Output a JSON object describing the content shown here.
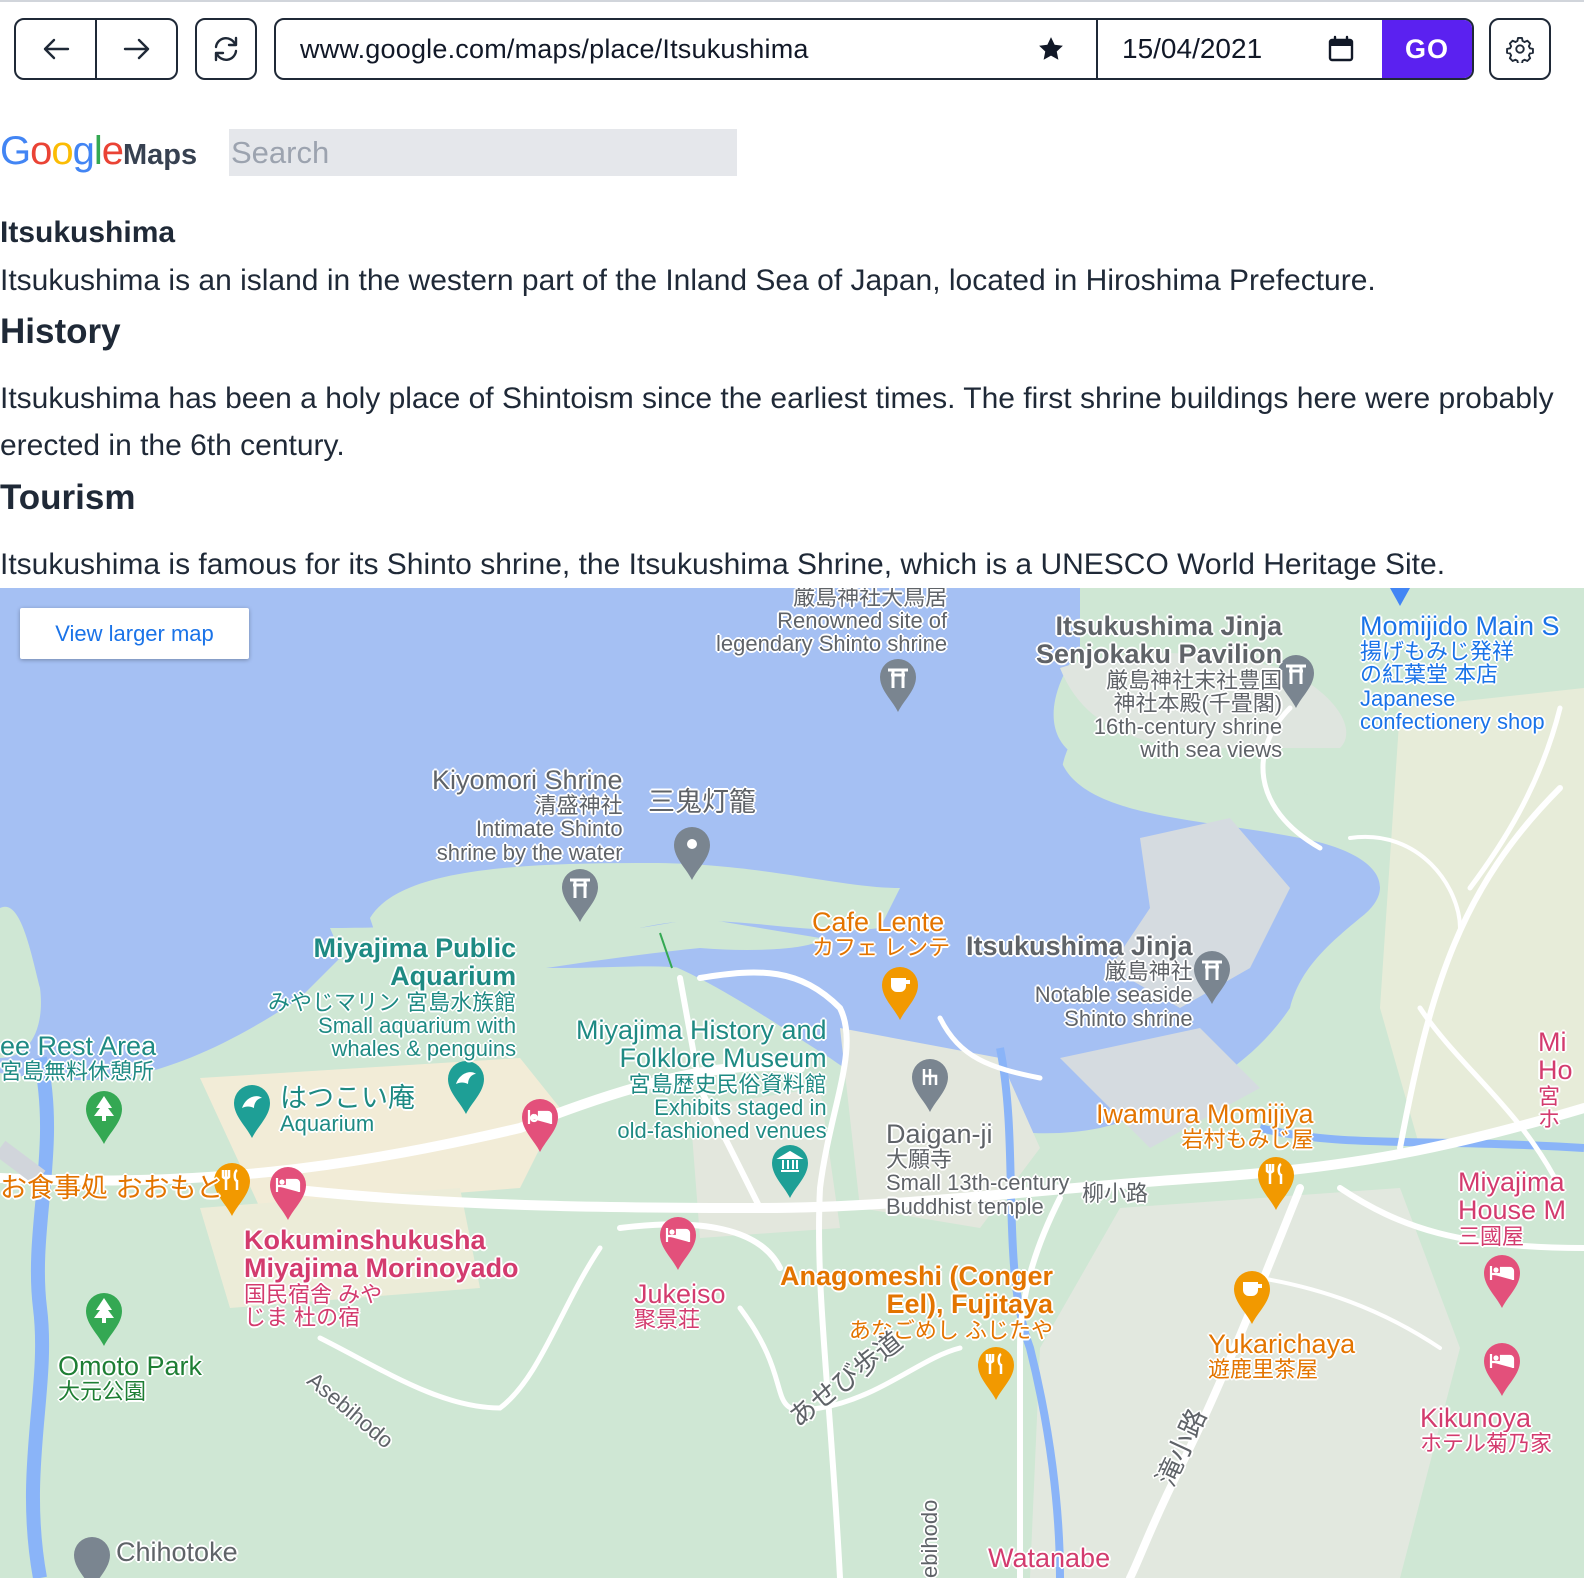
{
  "browser": {
    "url": "www.google.com/maps/place/Itsukushima",
    "date": "15/04/2021",
    "go_label": "GO",
    "icons": [
      "arrow-left-icon",
      "arrow-right-icon",
      "reload-icon",
      "star-icon",
      "calendar-icon",
      "gear-icon"
    ]
  },
  "header": {
    "logo_letters": [
      "G",
      "o",
      "o",
      "g",
      "l",
      "e"
    ],
    "maps_label": "Maps",
    "search_placeholder": "Search"
  },
  "article": {
    "title": "Itsukushima",
    "intro": "Itsukushima is an island in the western part of the Inland Sea of Japan, located in Hiroshima Prefecture.",
    "sections": [
      {
        "heading": "History",
        "body": "Itsukushima has been a holy place of Shintoism since the earliest times. The first shrine buildings here were probably erected in the 6th century."
      },
      {
        "heading": "Tourism",
        "body": "Itsukushima is famous for its Shinto shrine, the Itsukushima Shrine, which is a UNESCO World Heritage Site."
      }
    ]
  },
  "map": {
    "view_larger": "View larger map",
    "colors": {
      "water": "#a5c0f3",
      "land": "#cfe7d4",
      "road": "#ffffff",
      "river": "#8ab4f8"
    },
    "labels": {
      "torii": [
        "厳島神社大鳥居",
        "Renowned site of",
        "legendary Shinto shrine"
      ],
      "senjokaku": [
        "Itsukushima Jinja",
        "Senjokaku Pavilion",
        "厳島神社末社豊国",
        "神社本殿(千畳閣)",
        "16th-century shrine",
        "with sea views"
      ],
      "momijido": [
        "Momijido Main S",
        "揚げもみじ発祥",
        "の紅葉堂 本店",
        "Japanese",
        "confectionery shop"
      ],
      "kiyomori": [
        "Kiyomori Shrine",
        "清盛神社",
        "Intimate Shinto",
        "shrine by the water"
      ],
      "sanki": [
        "三鬼灯籠"
      ],
      "aquarium": [
        "Miyajima Public",
        "Aquarium",
        "みやじマリン 宮島水族館",
        "Small aquarium with",
        "whales & penguins"
      ],
      "cafe_lente": [
        "Cafe Lente",
        "カフェ レンテ"
      ],
      "jinja": [
        "Itsukushima Jinja",
        "厳島神社",
        "Notable seaside",
        "Shinto shrine"
      ],
      "rest_area": [
        "ee Rest Area",
        "宮島無料休憩所"
      ],
      "hatsukoi": [
        "はつこい庵",
        "Aquarium"
      ],
      "museum": [
        "Miyajima History and",
        "Folklore Museum",
        "宮島歴史民俗資料館",
        "Exhibits staged in",
        "old-fashioned venues"
      ],
      "daiganji": [
        "Daigan-ji",
        "大願寺",
        "Small 13th-century",
        "Buddhist temple"
      ],
      "iwamura": [
        "Iwamura Momijiya",
        "岩村もみじ屋"
      ],
      "yanagi": [
        "柳小路"
      ],
      "mi_ho": [
        "Mi",
        "Ho",
        "宮",
        "ホ"
      ],
      "oomoto": [
        "お食事処 おおもと"
      ],
      "kokumin": [
        "Kokuminshukusha",
        "Miyajima Morinoyado",
        "国民宿舎 みや",
        "じま 杜の宿"
      ],
      "jukeiso": [
        "Jukeiso",
        "聚景荘"
      ],
      "anagomeshi": [
        "Anagomeshi (Conger",
        "Eel), Fujitaya",
        "あなごめし ふじたや"
      ],
      "miyajima_house": [
        "Miyajima",
        "House M",
        "三國屋"
      ],
      "yukarichaya": [
        "Yukarichaya",
        "遊鹿里茶屋"
      ],
      "omoto_park": [
        "Omoto Park",
        "大元公園"
      ],
      "asebihodo": [
        "Asebihodo"
      ],
      "asebi_jp": [
        "あせび歩道"
      ],
      "kikunoya": [
        "Kikunoya",
        "ホテル菊乃家"
      ],
      "takikoji": [
        "滝小路"
      ],
      "ebihodo": [
        "ebihodo"
      ],
      "chihotoke": [
        "Chihotoke"
      ],
      "watanabe": [
        "Watanabe"
      ]
    }
  }
}
